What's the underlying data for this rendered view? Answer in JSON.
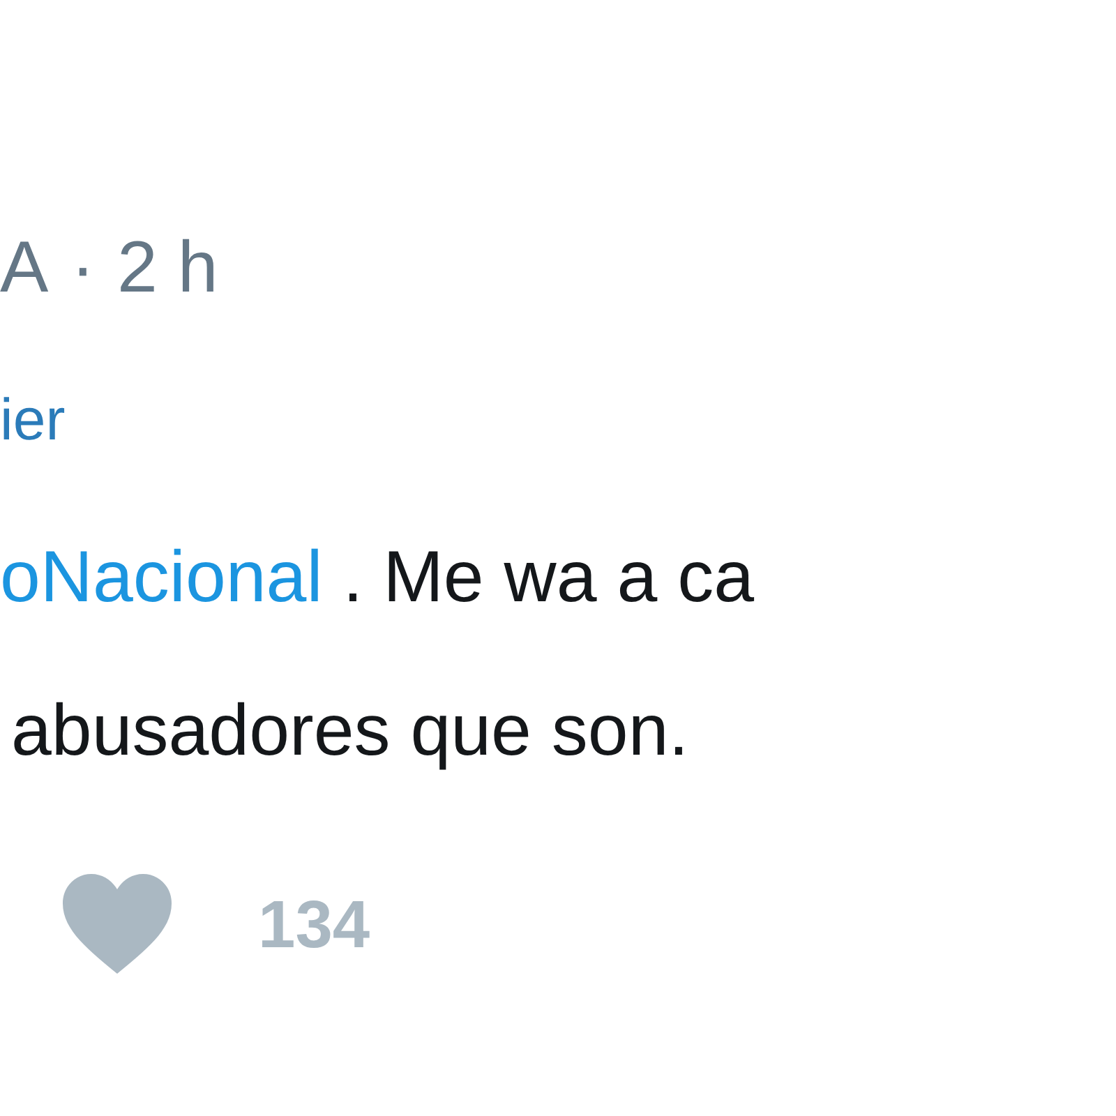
{
  "header": {
    "author": "A",
    "separator": "·",
    "time": "2 h"
  },
  "reply_to": "ier",
  "tweet": {
    "lines": [
      [
        {
          "kind": "link",
          "text": "oNacional"
        },
        {
          "kind": "text",
          "text": " . Me wa a ca"
        }
      ],
      [
        {
          "kind": "text",
          "text": "abusadores que son."
        }
      ]
    ]
  },
  "actions": {
    "likes": "134"
  }
}
